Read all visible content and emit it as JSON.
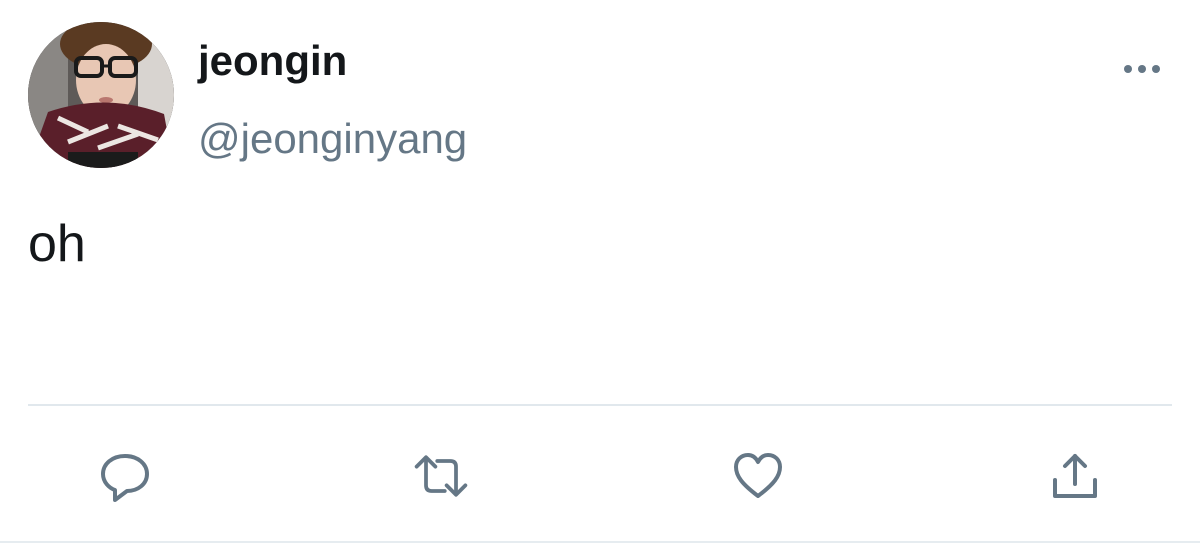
{
  "tweet": {
    "author": {
      "display_name": "jeongin",
      "handle": "@jeonginyang",
      "avatar_icon": "profile-photo"
    },
    "text": "oh",
    "actions": [
      {
        "name": "reply",
        "icon": "speech-bubble-icon"
      },
      {
        "name": "retweet",
        "icon": "retweet-arrows-icon"
      },
      {
        "name": "like",
        "icon": "heart-icon"
      },
      {
        "name": "share",
        "icon": "share-upload-icon"
      }
    ],
    "menu_icon": "more-dots-icon"
  },
  "colors": {
    "text_primary": "#14171a",
    "text_secondary": "#657786",
    "icon": "#657786",
    "divider": "#e1e8ed"
  }
}
